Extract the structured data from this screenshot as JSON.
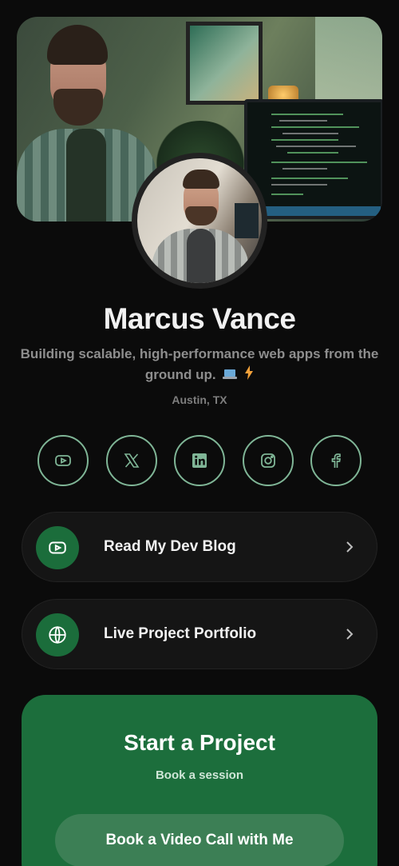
{
  "profile": {
    "name": "Marcus Vance",
    "bio": "Building scalable, high-performance web apps from the ground up.",
    "bio_emoji": [
      "laptop-icon",
      "lightning-icon"
    ],
    "location": "Austin, TX"
  },
  "social": [
    {
      "name": "youtube",
      "icon": "youtube-icon"
    },
    {
      "name": "x",
      "icon": "x-icon"
    },
    {
      "name": "linkedin",
      "icon": "linkedin-icon"
    },
    {
      "name": "instagram",
      "icon": "instagram-icon"
    },
    {
      "name": "facebook",
      "icon": "facebook-icon"
    }
  ],
  "links": [
    {
      "label": "Read My Dev Blog",
      "icon": "youtube-icon"
    },
    {
      "label": "Live Project Portfolio",
      "icon": "globe-icon"
    }
  ],
  "cta": {
    "title": "Start a Project",
    "subtitle": "Book a session",
    "button_label": "Book a Video Call with Me"
  },
  "colors": {
    "background": "#0b0b0b",
    "accent": "#1b6d3b",
    "social_ring": "#7fb596",
    "card": "#151515"
  }
}
